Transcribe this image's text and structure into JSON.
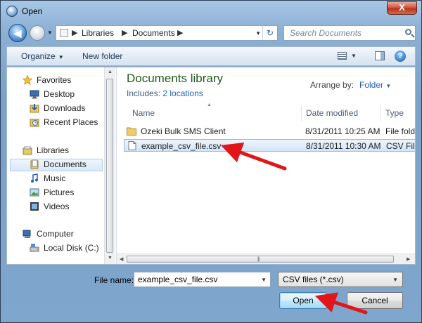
{
  "window": {
    "title": "Open",
    "close_glyph": "X"
  },
  "navigation": {
    "back_glyph": "◀",
    "breadcrumbs": [
      "Libraries",
      "Documents"
    ],
    "search_placeholder": "Search Documents"
  },
  "toolbar": {
    "organize_label": "Organize",
    "new_folder_label": "New folder",
    "help_glyph": "?"
  },
  "sidebar": {
    "favorites": {
      "label": "Favorites",
      "icon": "star-icon"
    },
    "favorite_items": [
      {
        "label": "Desktop",
        "icon": "desktop-icon"
      },
      {
        "label": "Downloads",
        "icon": "downloads-icon"
      },
      {
        "label": "Recent Places",
        "icon": "recent-places-icon"
      }
    ],
    "libraries": {
      "label": "Libraries",
      "icon": "libraries-icon"
    },
    "library_items": [
      {
        "label": "Documents",
        "icon": "documents-icon",
        "selected": true
      },
      {
        "label": "Music",
        "icon": "music-icon"
      },
      {
        "label": "Pictures",
        "icon": "pictures-icon"
      },
      {
        "label": "Videos",
        "icon": "videos-icon"
      }
    ],
    "computer": {
      "label": "Computer",
      "icon": "computer-icon"
    },
    "computer_items": [
      {
        "label": "Local Disk (C:)",
        "icon": "local-disk-icon"
      }
    ]
  },
  "library_header": {
    "title": "Documents library",
    "includes_label": "Includes:",
    "locations_link": "2 locations",
    "arrange_label": "Arrange by:",
    "arrange_value": "Folder"
  },
  "columns": {
    "name": "Name",
    "date_modified": "Date modified",
    "type": "Type"
  },
  "files": [
    {
      "name": "Ozeki Bulk SMS Client",
      "date": "8/31/2011 10:25 AM",
      "type": "File folder",
      "icon": "folder-icon",
      "selected": false
    },
    {
      "name": "example_csv_file.csv",
      "date": "8/31/2011 10:30 AM",
      "type": "CSV File",
      "icon": "file-icon",
      "selected": true
    }
  ],
  "footer": {
    "file_name_label": "File name:",
    "file_name_value": "example_csv_file.csv",
    "filter_value": "CSV files (*.csv)",
    "open_label": "Open",
    "cancel_label": "Cancel"
  },
  "colors": {
    "annotation_arrow": "#e0161b",
    "library_title": "#1e5a1e",
    "link": "#1d62b8"
  }
}
